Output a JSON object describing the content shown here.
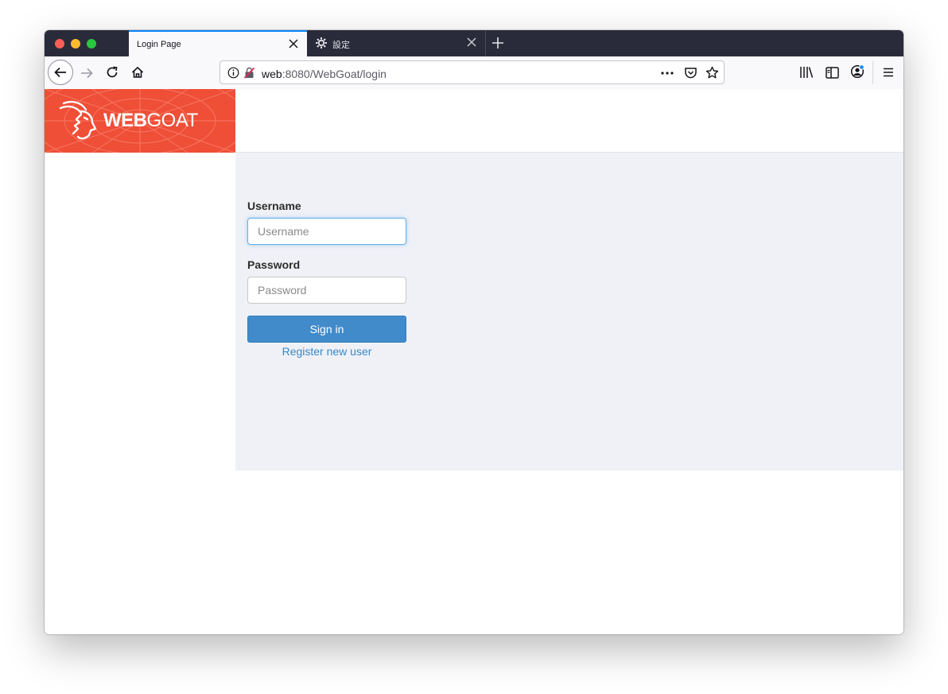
{
  "browser": {
    "tabs": [
      {
        "label": "Login Page",
        "active": true
      },
      {
        "label": "設定",
        "active": false
      }
    ],
    "url": {
      "host": "web",
      "rest": ":8080/WebGoat/login"
    }
  },
  "header": {
    "logo_bold": "WEB",
    "logo_light": "GOAT"
  },
  "login": {
    "username_label": "Username",
    "username_placeholder": "Username",
    "password_label": "Password",
    "password_placeholder": "Password",
    "signin_label": "Sign in",
    "register_label": "Register new user"
  },
  "colors": {
    "brand": "#ef4e37",
    "accent": "#428bca",
    "panel": "#eff1f6"
  }
}
